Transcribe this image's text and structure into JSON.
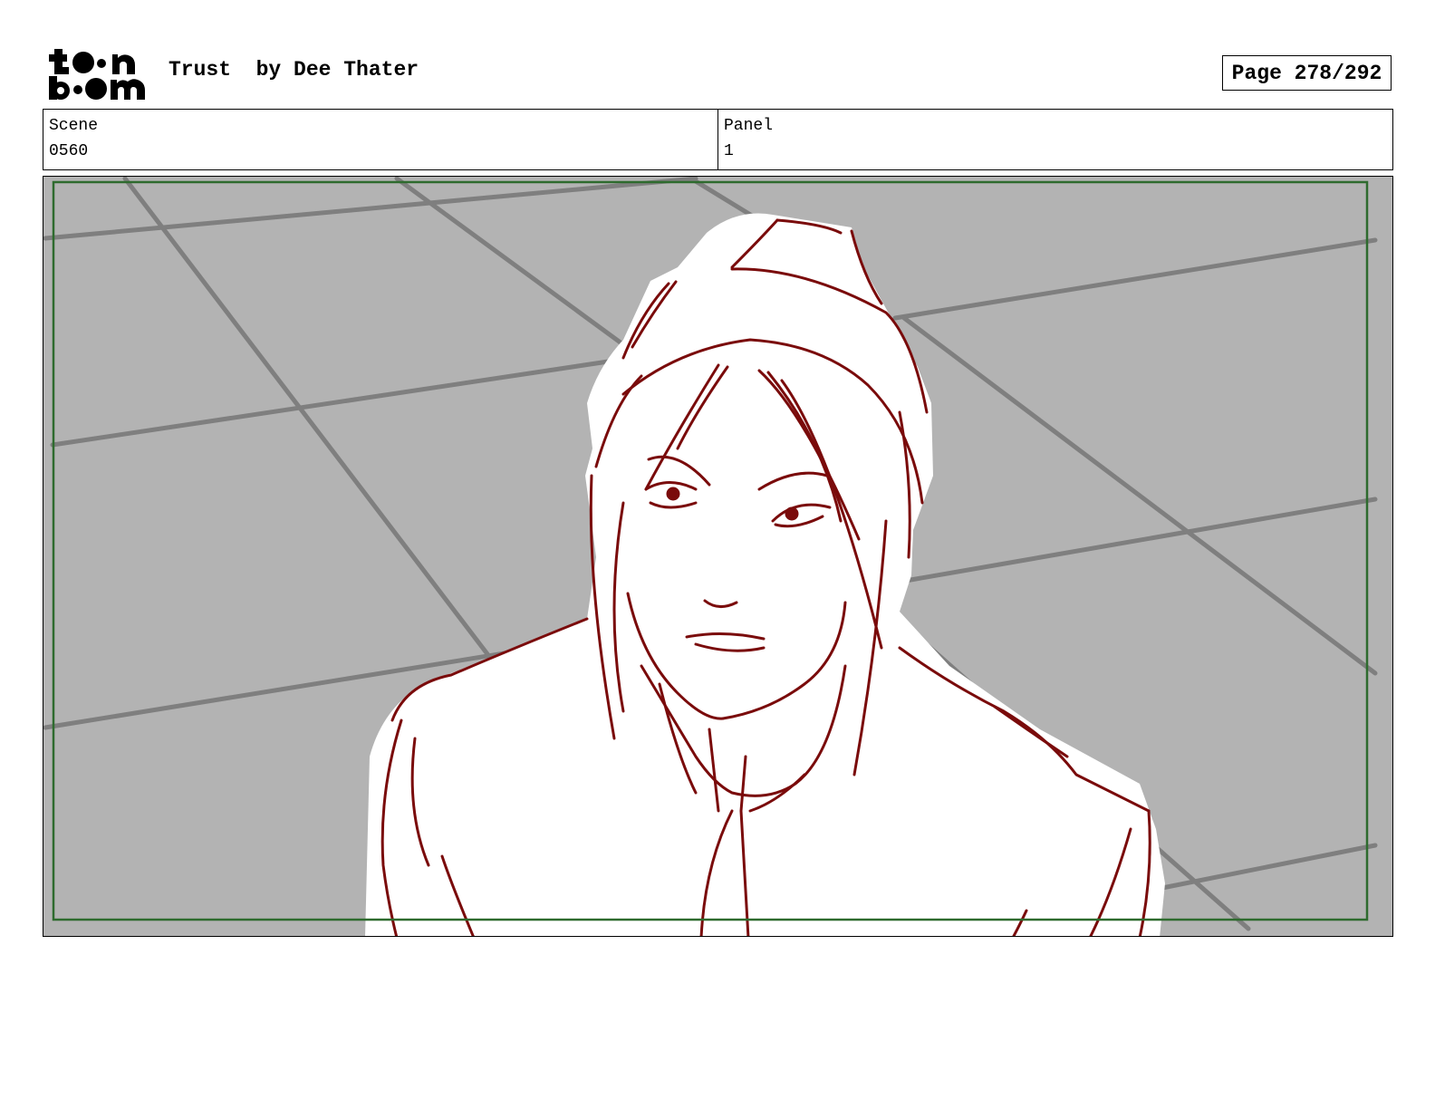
{
  "header": {
    "logo_text": "toon boom",
    "title": "Trust  by Dee Thater",
    "page": "Page 278/292"
  },
  "info": {
    "scene_label": "Scene",
    "scene_value": "0560",
    "panel_label": "Panel",
    "panel_value": "1"
  },
  "colors": {
    "safe_area": "#2e6b2e",
    "sketch_line": "#7a0b0b",
    "background_fill": "#b3b3b3",
    "floor_lines": "#808080"
  }
}
